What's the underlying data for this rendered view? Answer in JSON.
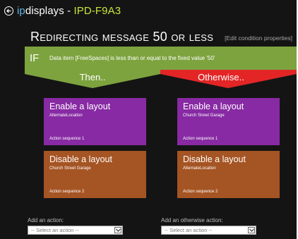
{
  "app": {
    "brand_prefix": "ip",
    "brand_suffix": "displays",
    "separator": " - ",
    "device_name": "IPD-F9A3"
  },
  "heading": "Redirecting message 50 or less",
  "edit_link": "[Edit condition properties]",
  "condition": {
    "if_label": "IF",
    "text": "Data item [FreeSpaces] is less than or equal to the fixed value '50'"
  },
  "branches": {
    "then_label": "Then..",
    "otherwise_label": "Otherwise..",
    "then_color": "#7da33e",
    "otherwise_color": "#e32526"
  },
  "then_actions": [
    {
      "title": "Enable a layout",
      "subject": "AlternateLocation",
      "sequence": "Action sequence 1",
      "color": "#872aa3"
    },
    {
      "title": "Disable a layout",
      "subject": "Church Street Garage",
      "sequence": "Action sequence 2",
      "color": "#a55423"
    }
  ],
  "otherwise_actions": [
    {
      "title": "Enable a layout",
      "subject": "Church Street Garage",
      "sequence": "Action sequence 1",
      "color": "#872aa3"
    },
    {
      "title": "Disable a layout",
      "subject": "AlternateLocation",
      "sequence": "Action sequence 2",
      "color": "#a55423"
    }
  ],
  "add_action": {
    "label": "Add an action:",
    "placeholder": "-- Select an action --"
  },
  "add_otherwise_action": {
    "label": "Add an otherwise action:",
    "placeholder": "-- Select an action --"
  },
  "icons": {
    "back": "back-arrow-circle-icon",
    "dropdown": "chevron-down-icon"
  }
}
